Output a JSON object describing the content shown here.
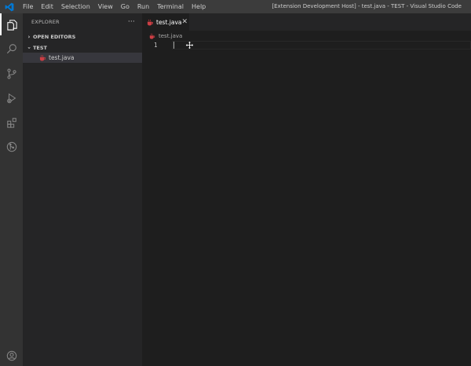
{
  "titlebar": {
    "menu": [
      "File",
      "Edit",
      "Selection",
      "View",
      "Go",
      "Run",
      "Terminal",
      "Help"
    ],
    "window_title": "[Extension Development Host] - test.java - TEST - Visual Studio Code",
    "logo_icon": "vscode-logo"
  },
  "activitybar": {
    "icons": [
      "explorer-icon",
      "search-icon",
      "source-control-icon",
      "run-debug-icon",
      "extensions-icon",
      "git-graph-icon"
    ],
    "account_icon": "account-icon"
  },
  "sidebar": {
    "title": "EXPLORER",
    "more_actions": "···",
    "open_editors_label": "OPEN EDITORS",
    "folder_label": "TEST",
    "files": [
      {
        "name": "test.java",
        "selected": true
      }
    ]
  },
  "editor": {
    "tab_label": "test.java",
    "tab_close": "✕",
    "breadcrumb": "test.java",
    "lines": [
      {
        "number": "1",
        "text": ""
      }
    ]
  },
  "colors": {
    "titlebar_bg": "#3c3c3c",
    "activitybar_bg": "#333333",
    "sidebar_bg": "#252526",
    "editor_bg": "#1e1e1e",
    "java_icon": "#cc3e44",
    "vscode_blue": "#0078d4"
  }
}
